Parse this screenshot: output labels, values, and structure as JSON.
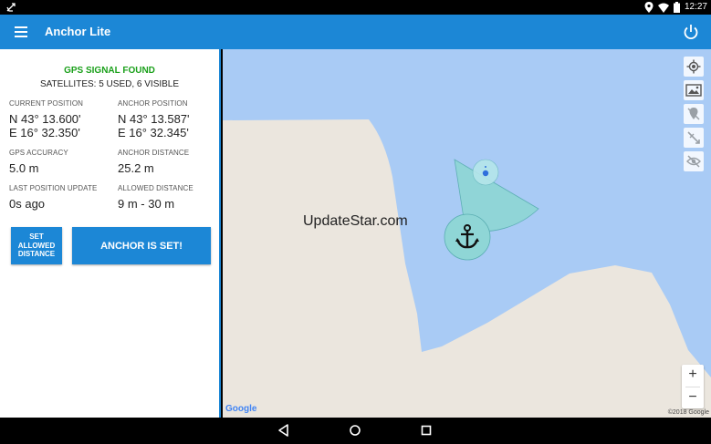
{
  "status_bar": {
    "time": "12:27"
  },
  "app_bar": {
    "title": "Anchor Lite"
  },
  "gps": {
    "status": "GPS SIGNAL FOUND",
    "satellites": "SATELLITES: 5 USED, 6 VISIBLE"
  },
  "fields": {
    "current_position": {
      "label": "CURRENT POSITION",
      "lat": "N 43° 13.600'",
      "lon": "E 16° 32.350'"
    },
    "anchor_position": {
      "label": "ANCHOR POSITION",
      "lat": "N 43° 13.587'",
      "lon": "E 16° 32.345'"
    },
    "gps_accuracy": {
      "label": "GPS ACCURACY",
      "value": "5.0 m"
    },
    "anchor_distance": {
      "label": "ANCHOR DISTANCE",
      "value": "25.2 m"
    },
    "last_update": {
      "label": "LAST POSITION UPDATE",
      "value": "0s ago"
    },
    "allowed_distance": {
      "label": "ALLOWED DISTANCE",
      "value": "9 m - 30 m"
    }
  },
  "buttons": {
    "set_allowed_distance": "SET ALLOWED DISTANCE",
    "anchor_is_set": "ANCHOR IS SET!"
  },
  "map": {
    "watermark": "UpdateStar.com",
    "google_logo": "Google",
    "copyright": "©2018 Google",
    "zoom_in": "+",
    "zoom_out": "−"
  },
  "colors": {
    "accent": "#1c87d6",
    "gps_ok": "#1aa01a",
    "water": "#a9cbf5",
    "land": "#ebe6de",
    "zone": "#8fd6d6"
  },
  "icons": [
    "anchor-icon",
    "location-icon",
    "wifi-icon",
    "battery-icon",
    "menu-icon",
    "power-icon",
    "my-location-icon",
    "map-layers-icon",
    "pin-off-icon",
    "anchor-line-icon",
    "visibility-off-icon",
    "back-icon",
    "home-icon",
    "recents-icon"
  ]
}
